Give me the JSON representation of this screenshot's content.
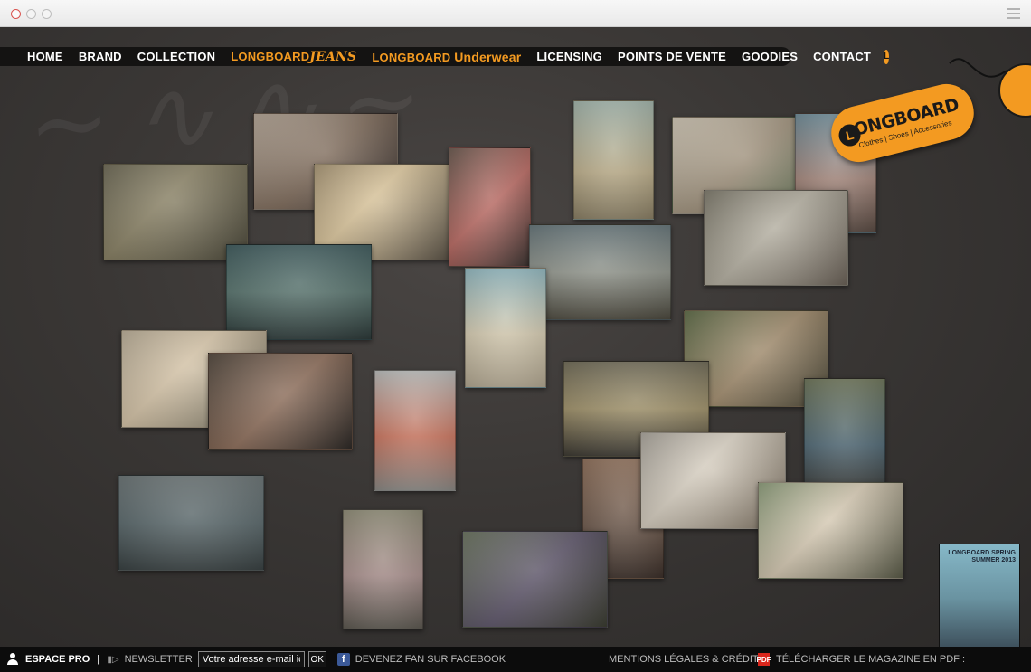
{
  "nav": {
    "items": [
      {
        "label": "HOME"
      },
      {
        "label": "BRAND"
      },
      {
        "label": "COLLECTION"
      },
      {
        "label": "LONGBOARD"
      },
      {
        "label": "JEANS"
      },
      {
        "label": "LONGBOARD"
      },
      {
        "label": "Underwear"
      },
      {
        "label": "LICENSING"
      },
      {
        "label": "POINTS DE VENTE"
      },
      {
        "label": "GOODIES"
      },
      {
        "label": "CONTACT"
      }
    ],
    "logo_glyph": "L"
  },
  "brand_tag": {
    "name": "LONGBOARD",
    "tagline": "Clothes | Shoes | Accessories"
  },
  "magazine": {
    "title": "LONGBOARD SPRING SUMMER 2013"
  },
  "footer": {
    "espace_pro": "ESPACE PRO",
    "separator": "|",
    "newsletter": "NEWSLETTER",
    "email_value": "Votre adresse e-mail ici",
    "ok": "OK",
    "facebook": "DEVENEZ FAN SUR FACEBOOK",
    "legal": "MENTIONS LÉGALES & CRÉDITS",
    "pdf": "TÉLÉCHARGER LE MAGAZINE EN PDF :"
  },
  "icons": {
    "user": "user-icon",
    "speaker": "speaker-icon",
    "facebook": "facebook-icon",
    "pdf": "pdf-icon"
  },
  "colors": {
    "accent": "#f39a21",
    "background": "#2d2b2a",
    "footer": "#0c0c0c"
  }
}
